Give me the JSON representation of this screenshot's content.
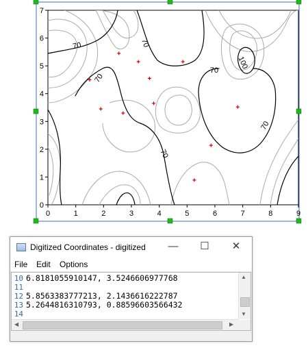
{
  "plot": {
    "x_ticks": [
      "0",
      "1",
      "2",
      "3",
      "4",
      "5",
      "6",
      "7",
      "8",
      "9"
    ],
    "y_ticks": [
      "0",
      "1",
      "2",
      "3",
      "4",
      "5",
      "6",
      "7"
    ],
    "contour_labels": [
      "70",
      "70",
      "70",
      "70",
      "70",
      "100",
      "70"
    ],
    "digitized_points": [
      {
        "x": 2.55,
        "y": 5.45
      },
      {
        "x": 3.25,
        "y": 5.15
      },
      {
        "x": 4.85,
        "y": 5.15
      },
      {
        "x": 1.5,
        "y": 4.5
      },
      {
        "x": 3.65,
        "y": 4.55
      },
      {
        "x": 3.8,
        "y": 3.65
      },
      {
        "x": 1.9,
        "y": 3.45
      },
      {
        "x": 2.7,
        "y": 3.3
      },
      {
        "x": 6.82,
        "y": 3.52
      },
      {
        "x": 5.86,
        "y": 2.14
      },
      {
        "x": 5.26,
        "y": 0.89
      }
    ],
    "colors": {
      "frame": "#3c6fb6",
      "handle": "#1fb81f",
      "marker": "#cc0000",
      "dark_contour": "#000000",
      "light_contour": "#aaaaaa"
    }
  },
  "window": {
    "title": "Digitized Coordinates - digitized",
    "minimize": "—",
    "maximize": "☐",
    "close": "✕"
  },
  "menu": {
    "file": "File",
    "edit": "Edit",
    "options": "Options"
  },
  "editor": {
    "lines": [
      {
        "no": "10",
        "text": "6.8181055910147, 3.5246606977768"
      },
      {
        "no": "11",
        "text": ""
      },
      {
        "no": "12",
        "text": "5.8563383777213, 2.1436616222787"
      },
      {
        "no": "13",
        "text": "5.2644816310793, 0.88596603566432"
      },
      {
        "no": "14",
        "text": ""
      }
    ]
  }
}
